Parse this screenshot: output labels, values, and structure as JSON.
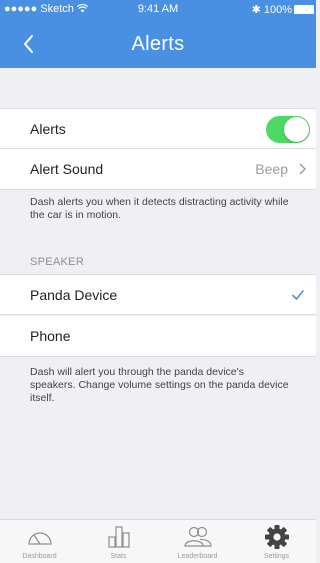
{
  "status_bar": {
    "carrier": "●●●●● Sketch",
    "time": "9:41 AM",
    "battery": "✱ 100%",
    "wifi_icon": "wifi-icon",
    "battery_icon": "battery-icon"
  },
  "nav": {
    "title": "Alerts",
    "back_icon": "chevron-left-icon"
  },
  "colors": {
    "accent": "#4a90e2",
    "toggle_on": "#4cd964",
    "background": "#efeff4"
  },
  "alerts": {
    "label": "Alerts",
    "toggle_on": true
  },
  "alert_sound": {
    "label": "Alert Sound",
    "value": "Beep"
  },
  "alerts_note": "Dash alerts you when it detects distracting activity while the car is in motion.",
  "speaker": {
    "header": "SPEAKER",
    "options": [
      {
        "label": "Panda Device",
        "selected": true
      },
      {
        "label": "Phone",
        "selected": false
      }
    ],
    "note": "Dash will alert you through the panda device's speakers. Change volume settings on the panda device itself."
  },
  "tabs": [
    {
      "label": "Dashboard",
      "icon": "speedometer-icon"
    },
    {
      "label": "Stats",
      "icon": "bar-chart-icon"
    },
    {
      "label": "Leaderboard",
      "icon": "users-icon"
    },
    {
      "label": "Settings",
      "icon": "gear-icon",
      "active": true
    }
  ]
}
